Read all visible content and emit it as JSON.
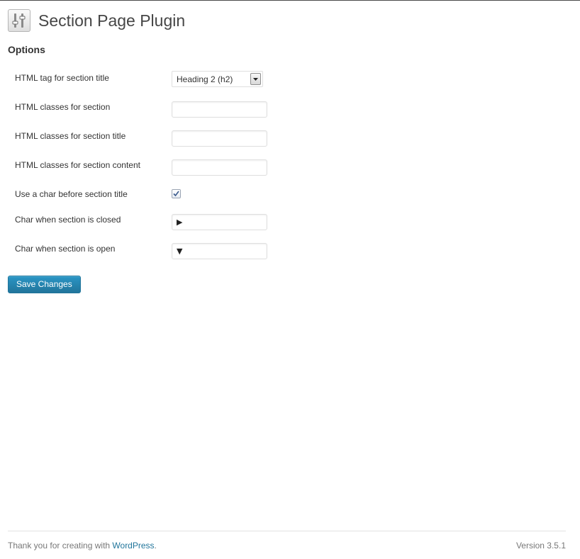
{
  "header": {
    "icon": "settings-sliders-icon",
    "title": "Section Page Plugin"
  },
  "options": {
    "heading": "Options",
    "rows": [
      {
        "label": "HTML tag for section title",
        "type": "select",
        "value": "Heading 2 (h2)"
      },
      {
        "label": "HTML classes for section",
        "type": "text",
        "value": ""
      },
      {
        "label": "HTML classes for section title",
        "type": "text",
        "value": ""
      },
      {
        "label": "HTML classes for section content",
        "type": "text",
        "value": ""
      },
      {
        "label": "Use a char before section title",
        "type": "checkbox",
        "checked": true
      },
      {
        "label": "Char when section is closed",
        "type": "text",
        "value": "▶"
      },
      {
        "label": "Char when section is open",
        "type": "text",
        "value": "▼"
      }
    ]
  },
  "actions": {
    "save_label": "Save Changes"
  },
  "footer": {
    "thanks_text": "Thank you for creating with ",
    "wordpress_link": "WordPress",
    "period": ".",
    "version": "Version 3.5.1"
  },
  "colors": {
    "accent": "#21759b",
    "text": "#333333",
    "muted": "#777777"
  }
}
